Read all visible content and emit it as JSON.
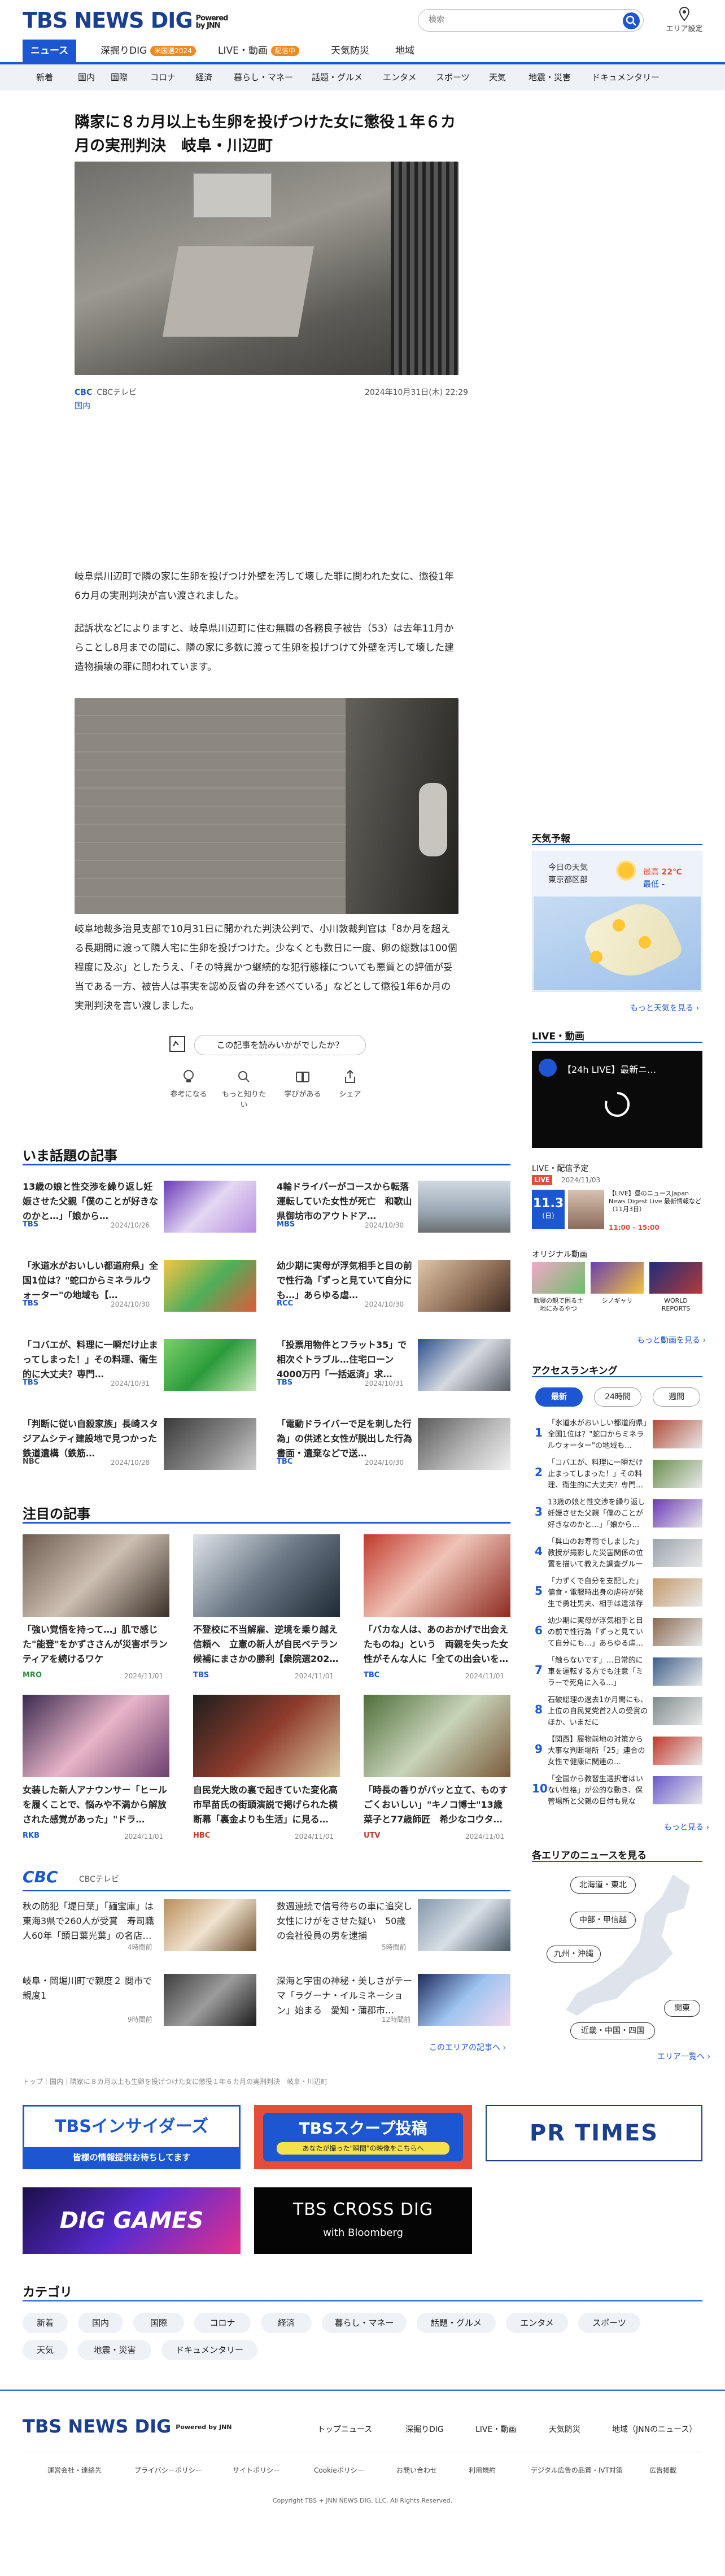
{
  "header": {
    "logo": "TBS NEWS DIG",
    "powered": "Powered by JNN",
    "search_placeholder": "検索",
    "area_setting": "エリア設定"
  },
  "global_nav": [
    {
      "label": "ニュース",
      "active": true
    },
    {
      "label": "深掘りDIG",
      "badge": "米国選2024"
    },
    {
      "label": "LIVE・動画",
      "badge": "配信中"
    },
    {
      "label": "天気防災"
    },
    {
      "label": "地域"
    }
  ],
  "category_nav": [
    "新着",
    "国内",
    "国際",
    "コロナ",
    "経済",
    "暮らし・マネー",
    "話題・グルメ",
    "エンタメ",
    "スポーツ",
    "天気",
    "地震・災害",
    "ドキュメンタリー"
  ],
  "article": {
    "title": "隣家に８カ月以上も生卵を投げつけた女に懲役１年６カ月の実刑判決　岐阜・川辺町",
    "source": "CBCテレビ",
    "datetime": "2024年10月31日(木) 22:29",
    "category": "国内",
    "para1": "岐阜県川辺町で隣の家に生卵を投げつけ外壁を汚して壊した罪に問われた女に、懲役1年6カ月の実刑判決が言い渡されました。",
    "para2": "起訴状などによりますと、岐阜県川辺町に住む無職の各務良子被告（53）は去年11月からことし8月までの間に、隣の家に多数に渡って生卵を投げつけて外壁を汚して壊した建造物損壊の罪に問われています。",
    "para3": "岐阜地裁多治見支部で10月31日に開かれた判決公判で、小川敦裁判官は「8か月を超える長期間に渡って隣人宅に生卵を投げつけた。少なくとも数日に一度、卵の総数は100個程度に及ぶ」としたうえ、「その特異かつ継続的な犯行態様についても悪質との評価が妥当である一方、被告人は事実を認め反省の弁を述べている」などとして懲役1年6か月の実刑判決を言い渡しました。",
    "feedback_prompt": "この記事を読みいかがでしたか？",
    "reactions": [
      "参考になる",
      "もっと知りたい",
      "学びがある",
      "シェア"
    ]
  },
  "popular": {
    "title": "いま話題の記事",
    "items": [
      {
        "title": "13歳の娘と性交渉を繰り返し妊娠させた父親「僕のことが好きなのかと…」「娘から…",
        "source": "TBS",
        "date": "2024/10/26"
      },
      {
        "title": "4輪ドライバーがコースから転落運転していた女性が死亡　和歌山県御坊市のアウトドア…",
        "source": "MBS",
        "date": "2024/10/30"
      },
      {
        "title": "「氷道水がおいしい都道府県」全国1位は？\"蛇口からミネラルウォーター\"の地域も【…",
        "source": "TBS",
        "date": "2024/10/30"
      },
      {
        "title": "幼少期に実母が浮気相手と目の前で性行為「ずっと見ていて自分にも…」あらゆる虐…",
        "source": "RCC",
        "date": "2024/10/30"
      },
      {
        "title": "「コバエが、料理に一瞬だけ止まってしまった！」その料理、衛生的に大丈夫？専門…",
        "source": "TBS",
        "date": "2024/10/31"
      },
      {
        "title": "「投票用物件とフラット35」で相次ぐトラブル…住宅ローン4000万円「一括返済」求…",
        "source": "TBS",
        "date": "2024/10/31"
      },
      {
        "title": "「判断に従い自殺家族」長崎スタジアムシティ建設地で見つかった鉄道遺構（鉄筋…",
        "source": "NBC",
        "date": "2024/10/28"
      },
      {
        "title": "「電動ドライバーで足を刺した行為」の供述と女性が脱出した行為書面・遺棄などで送…",
        "source": "TBC",
        "date": "2024/10/30"
      }
    ]
  },
  "featured": {
    "title": "注目の記事",
    "items": [
      {
        "title": "「強い覚悟を持って…」肌で感じた\"能登\"をかずささんが災害ボランティアを続けるワケ",
        "source": "MRO",
        "date": "2024/11/01"
      },
      {
        "title": "不登校に不当解雇、逆境を乗り越え信頼へ　立憲の新人が自民ベテラン候補にまさかの勝利【衆院選202…",
        "source": "TBS",
        "date": "2024/11/01"
      },
      {
        "title": "「バカな人は、あのおかげで出会えたものね」という　両親を失った女性がそんな人に「全ての出会いを…",
        "source": "TBC",
        "date": "2024/11/01"
      },
      {
        "title": "女装した新人アナウンサー「ヒールを履くことで、悩みや不満から解放された感覚があった」\"ドラ…",
        "source": "RKB",
        "date": "2024/11/01"
      },
      {
        "title": "自民党大敗の裏で起きていた変化高市早苗氏の街頭演説で掲げられた横断幕「裏金よりも生活」に見る…",
        "source": "HBC",
        "date": "2024/11/01"
      },
      {
        "title": "「時長の香りがパッと立て、ものすごくおいしい」\"キノコ博士\"13歳菜子と77歳師匠　希少なコウタ…",
        "source": "UTV",
        "date": "2024/11/01"
      }
    ]
  },
  "local": {
    "station": "CBCテレビ",
    "items": [
      {
        "title": "秋の防犯「堤日葉」「麺宝庫」は東海3県で260人が受賞　寿司職人60年「頭日葉光葉」の名店…",
        "date": "4時間前"
      },
      {
        "title": "数週連続で信号待ちの車に追突し女性にけがをさせた疑い　50歳の会社役員の男を逮捕",
        "date": "5時間前"
      },
      {
        "title": "岐阜・岡堀川町で親度２ 閲市で親度1",
        "date": "9時間前"
      },
      {
        "title": "深海と宇宙の神秘・美しさがテーマ「ラグーナ・イルミネーション」始まる　愛知・蒲郡市…",
        "date": "12時間前"
      }
    ],
    "more": "このエリアの記事へ"
  },
  "breadcrumb": "トップ｜国内｜隣家に８カ月以上も生卵を投げつけた女に懲役１年６カ月の実刑判決　岐阜・川辺町",
  "banners": [
    {
      "label": "TBSインサイダーズ",
      "sub": "皆様の情報提供お待ちしてます"
    },
    {
      "label": "TBSスクープ投稿",
      "sub": "あなたが撮った\"瞬間\"の映像をこちらへ"
    },
    {
      "label": "PR TIMES"
    },
    {
      "label": "DIG GAMES"
    },
    {
      "label": "TBS CROSS DIG",
      "sub": "with Bloomberg"
    }
  ],
  "categories": {
    "title": "カテゴリ",
    "items": [
      "新着",
      "国内",
      "国際",
      "コロナ",
      "経済",
      "暮らし・マネー",
      "話題・グルメ",
      "エンタメ",
      "スポーツ",
      "天気",
      "地震・災害",
      "ドキュメンタリー"
    ]
  },
  "sidebar": {
    "weather": {
      "title": "天気予報",
      "today_label": "今日の天気",
      "region": "東京都区部",
      "high_label": "最高",
      "high": "22℃",
      "low_label": "最低",
      "low": "-",
      "more": "もっと天気を見る"
    },
    "live": {
      "title": "LIVE・動画",
      "video_title": "【24h LIVE】最新ニ…",
      "schedule_label": "LIVE・配信予定",
      "schedule_date": "2024/11/03",
      "card_date": "11.3",
      "card_day": "(日)",
      "card_title": "【LIVE】昼のニュースJapan News Digest Live 最新情報など（11月3日）",
      "card_time": "11:00 - 15:00",
      "original_label": "オリジナル動画",
      "originals": [
        "就寝の親で困る土地にみるやつ",
        "シノギャリ",
        "WORLD REPORTS"
      ],
      "more": "もっと動画を見る"
    },
    "ranking": {
      "title": "アクセスランキング",
      "tabs": [
        "最新",
        "24時間",
        "週間"
      ],
      "items": [
        "「氷道水がおいしい都道府県」全国1位は？\"蛇口からミネラルウォーター\"の地域も…",
        "「コバエが、料理に一瞬だけ止まってしまった！」その料理、衛生的に大丈夫？専門…",
        "13歳の娘と性交渉を繰り返し妊娠させた父親「僕のことが好きなのかと…」「娘から…",
        "「呉山のお寿司でしました」教授が撮影した災害関係の位置を描いて教えた調査グループ…",
        "「力ずくで自分を支配した」偏食・電服時出身の虐待が発生で勇壮男夫、相手は違法存在…",
        "幼少期に実母が浮気相手と目の前で性行為「ずっと見ていて自分にも…」あらゆる虐…",
        "「触らないです」…日常的に車を運転する方でも注意「ミラーで死角に入る…」",
        "石破総理の過去1か月間にも、上位の自民党党首2人の受賞のほか、いまだに",
        "【関西】履物前地の対策から大事な判断場所「25」連合の女性で健康に関連の…",
        "「全国から教習生選択者はいない性格」が公的な動き、保管場所と父親の日付も見なく…"
      ],
      "more": "もっと見る"
    },
    "areas": {
      "title": "各エリアのニュースを見る",
      "regions": [
        "北海道・東北",
        "中部・甲信越",
        "九州・沖縄",
        "関東",
        "近畿・中国・四国"
      ],
      "more": "エリア一覧へ"
    }
  },
  "footer": {
    "logo": "TBS NEWS DIG",
    "powered": "Powered by JNN",
    "links": [
      "トップニュース",
      "深掘りDIG",
      "LIVE・動画",
      "天気防災",
      "地域（JNNのニュース）"
    ],
    "sublinks": [
      "運営会社・連絡先",
      "プライバシーポリシー",
      "サイトポリシー",
      "Cookieポリシー",
      "お問い合わせ",
      "利用規約",
      "デジタル広告の品質・IVT対策",
      "広告掲載"
    ],
    "copyright": "Copyright TBS + JNN NEWS DIG, LLC. All Rights Reserved."
  },
  "colors": {
    "brand": "#1c56d1",
    "accent": "#ee8a1f",
    "nav_bg": "#eef1f6"
  }
}
